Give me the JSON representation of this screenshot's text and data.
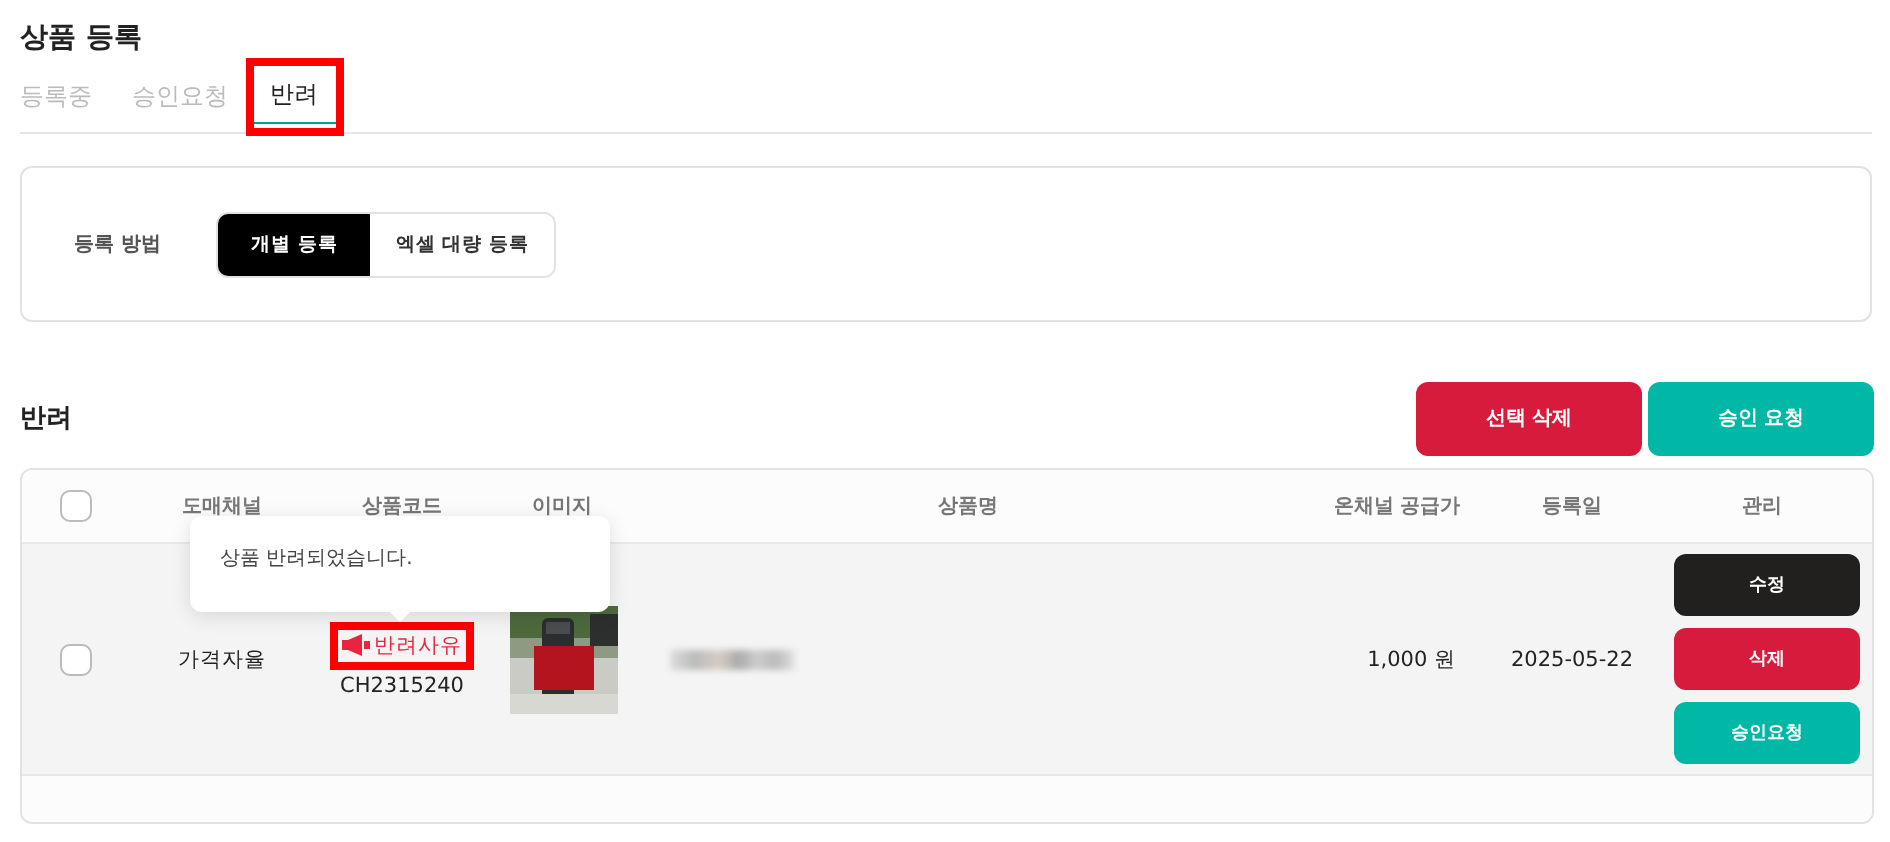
{
  "page": {
    "title": "상품 등록"
  },
  "tabs": [
    {
      "label": "등록중",
      "selected": false,
      "highlighted": false
    },
    {
      "label": "승인요청",
      "selected": false,
      "highlighted": false
    },
    {
      "label": "반려",
      "selected": true,
      "highlighted": true
    }
  ],
  "registration_method": {
    "label": "등록 방법",
    "options": [
      {
        "label": "개별 등록",
        "selected": true
      },
      {
        "label": "엑셀 대량 등록",
        "selected": false
      }
    ]
  },
  "section": {
    "title": "반려",
    "buttons": [
      {
        "label": "선택 삭제",
        "kind": "danger"
      },
      {
        "label": "승인 요청",
        "kind": "primary"
      }
    ]
  },
  "table": {
    "select_all": {
      "checked": false
    },
    "columns": [
      "도매채널",
      "상품코드",
      "이미지",
      "상품명",
      "온채널 공급가",
      "등록일",
      "관리"
    ],
    "rows": [
      {
        "checked": false,
        "channel": "가격자율",
        "reject_reason": {
          "label": "반려사유",
          "highlighted": true
        },
        "code": "CH2315240",
        "name_redacted": true,
        "price": "1,000 원",
        "date": "2025-05-22",
        "actions": [
          {
            "label": "수정",
            "kind": "dark"
          },
          {
            "label": "삭제",
            "kind": "danger"
          },
          {
            "label": "승인요청",
            "kind": "primary"
          }
        ]
      }
    ]
  },
  "tooltip": {
    "text": "상품 반려되었습니다."
  }
}
